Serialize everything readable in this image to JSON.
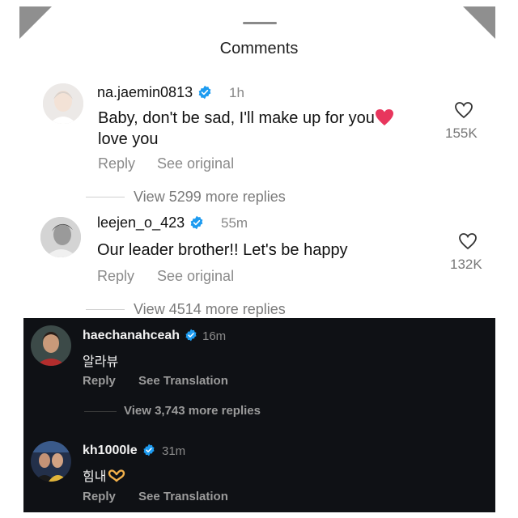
{
  "header": {
    "title": "Comments"
  },
  "comments": [
    {
      "username": "na.jaemin0813",
      "time": "1h",
      "text_line1": "Baby, don't be sad, I'll make up for you",
      "text_line2": "love you",
      "likes": "155K",
      "reply_label": "Reply",
      "see_label": "See original",
      "more_replies": "View 5299 more replies"
    },
    {
      "username": "leejen_o_423",
      "time": "55m",
      "text_line1": "Our leader brother!! Let's be happy",
      "likes": "132K",
      "reply_label": "Reply",
      "see_label": "See original",
      "more_replies": "View 4514 more replies"
    }
  ],
  "dark_comments": [
    {
      "username": "haechanahceah",
      "time": "16m",
      "text": "알라뷰",
      "reply_label": "Reply",
      "see_label": "See Translation",
      "more_replies": "View 3,743 more replies"
    },
    {
      "username": "kh1000le",
      "time": "31m",
      "text": "힘내",
      "reply_label": "Reply",
      "see_label": "See Translation"
    }
  ],
  "colors": {
    "verified": "#1d9bf0",
    "heart_emoji": "#e8365d",
    "dark_bg": "#0f1115"
  },
  "icons": [
    "verified-badge-icon",
    "heart-outline-icon",
    "red-heart-emoji-icon",
    "heart-hands-emoji-icon"
  ]
}
